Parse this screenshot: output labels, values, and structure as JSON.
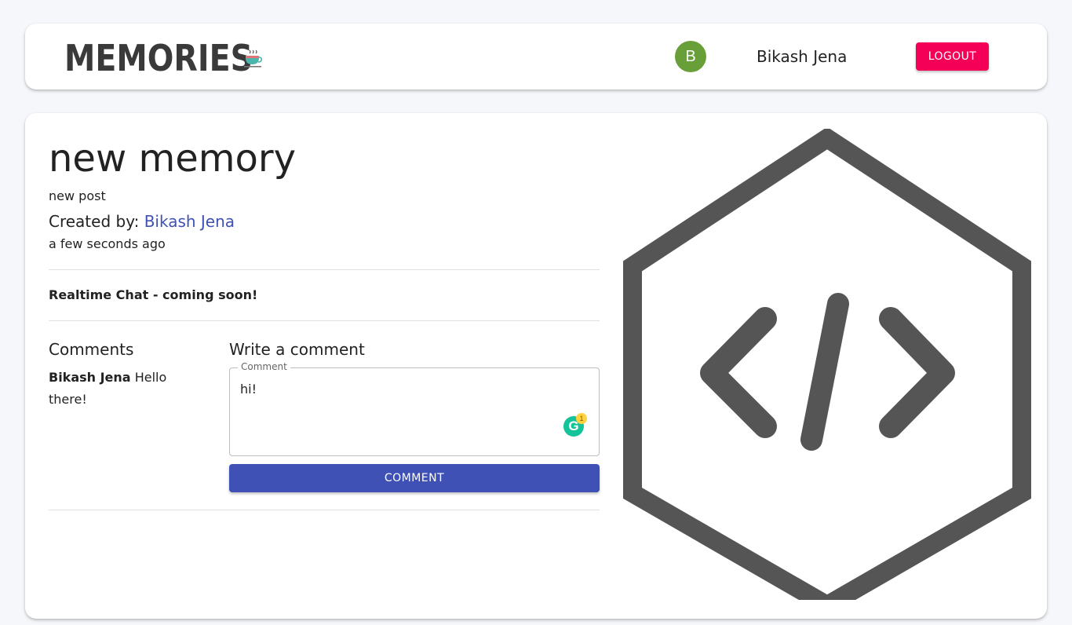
{
  "header": {
    "brand": "Memories",
    "brand_icon": "coffee-cup-icon",
    "user_initial": "B",
    "user_name": "Bikash Jena",
    "logout_label": "LOGOUT",
    "avatar_color": "#689f38",
    "logout_color": "#f50057"
  },
  "post": {
    "title": "new memory",
    "message": "new post",
    "created_by_label": "Created by:",
    "creator": "Bikash Jena",
    "time_ago": "a few seconds ago",
    "chat_note": "Realtime Chat - coming soon!",
    "image_icon": "code-hexagon-icon"
  },
  "comments": {
    "heading": "Comments",
    "items": [
      {
        "author": "Bikash Jena",
        "text": "Hello there!"
      }
    ]
  },
  "write_comment": {
    "heading": "Write a comment",
    "field_label": "Comment",
    "value": "hi!",
    "grammarly_letter": "G",
    "grammarly_count": "1",
    "submit_label": "COMMENT",
    "submit_color": "#3f51b5"
  }
}
